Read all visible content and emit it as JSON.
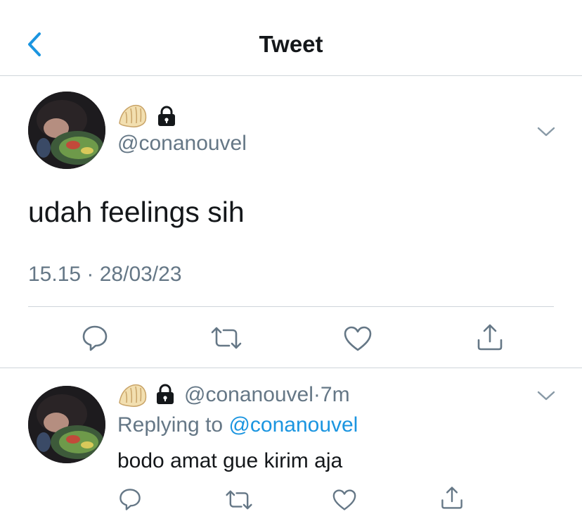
{
  "header": {
    "title": "Tweet",
    "back_icon": "chevron-left-icon"
  },
  "tweet": {
    "emoji": "dumpling-emoji",
    "lock_icon": "lock-icon",
    "handle": "@conanouvel",
    "text": "udah feelings sih",
    "timestamp": "15.15 · 28/03/23",
    "actions": [
      "reply-icon",
      "retweet-icon",
      "like-icon",
      "share-icon"
    ]
  },
  "reply": {
    "handle": "@conanouvel",
    "separator": "·",
    "time": "7m",
    "replying_prefix": "Replying to",
    "replying_to": "@conanouvel",
    "text": "bodo amat gue kirim aja",
    "actions": [
      "reply-icon",
      "retweet-icon",
      "like-icon",
      "share-icon"
    ]
  },
  "colors": {
    "accent": "#1b95e0",
    "secondary_text": "#657786",
    "primary_text": "#14171a",
    "divider": "#cfd5da"
  }
}
